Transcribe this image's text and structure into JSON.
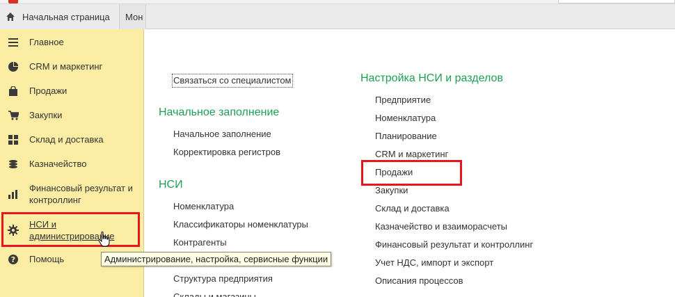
{
  "tabs": {
    "home_label": "Начальная страница",
    "next_label": "Мон"
  },
  "sidebar": {
    "items": [
      {
        "label": "Главное",
        "icon": "menu-lines-icon"
      },
      {
        "label": "CRM и маркетинг",
        "icon": "pie-chart-icon"
      },
      {
        "label": "Продажи",
        "icon": "shopping-bag-icon"
      },
      {
        "label": "Закупки",
        "icon": "cart-icon"
      },
      {
        "label": "Склад и доставка",
        "icon": "warehouse-grid-icon"
      },
      {
        "label": "Казначейство",
        "icon": "coins-icon"
      },
      {
        "label": "Финансовый результат и контроллинг",
        "icon": "bar-chart-icon"
      },
      {
        "label": "НСИ и администрирование",
        "icon": "gear-icon"
      },
      {
        "label": "Помощь",
        "icon": "question-icon"
      }
    ]
  },
  "tooltip": "Администрирование, настройка, сервисные функции",
  "left_column": {
    "contact_link": "Связаться со специалистом",
    "groups": [
      {
        "title": "Начальное заполнение",
        "links": [
          "Начальное заполнение",
          "Корректировка регистров"
        ]
      },
      {
        "title": "НСИ",
        "links": [
          "Номенклатура",
          "Классификаторы номенклатуры",
          "Контрагенты",
          "",
          "Структура предприятия",
          "Склады и магазины"
        ]
      }
    ]
  },
  "right_column": {
    "title": "Настройка НСИ и разделов",
    "links": [
      "Предприятие",
      "Номенклатура",
      "Планирование",
      "CRM и маркетинг",
      "Продажи",
      "Закупки",
      "Склад и доставка",
      "Казначейство и взаиморасчеты",
      "Финансовый результат и контроллинг",
      "Учет НДС, импорт и экспорт",
      "Описания процессов"
    ]
  },
  "colors": {
    "sidebar_bg": "#fbeda4",
    "group_title": "#1e9f52",
    "highlight": "#e8151d"
  }
}
